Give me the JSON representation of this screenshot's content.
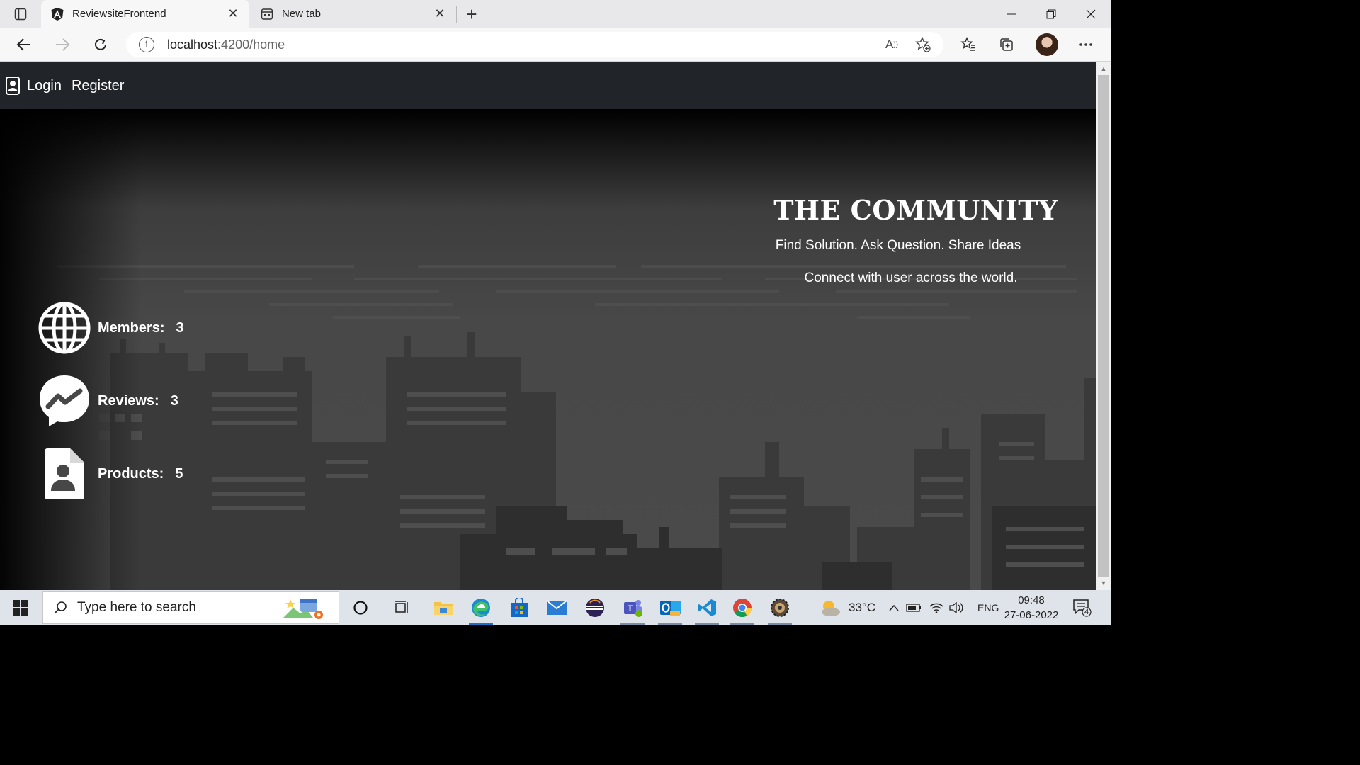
{
  "browser": {
    "tabs": [
      {
        "title": "ReviewsiteFrontend",
        "active": true
      },
      {
        "title": "New tab",
        "active": false
      }
    ],
    "url_host": "localhost",
    "url_path": ":4200/home"
  },
  "navbar": {
    "login_label": "Login",
    "register_label": "Register"
  },
  "hero": {
    "title": "THE COMMUNITY",
    "tagline": "Find Solution. Ask Question. Share Ideas",
    "subtitle": "Connect with user across the world."
  },
  "stats": [
    {
      "icon": "globe-icon",
      "label": "Members:",
      "value": "3"
    },
    {
      "icon": "chat-icon",
      "label": "Reviews:",
      "value": "3"
    },
    {
      "icon": "document-user-icon",
      "label": "Products:",
      "value": "5"
    }
  ],
  "taskbar": {
    "search_placeholder": "Type here to search",
    "weather": "33°C",
    "language": "ENG",
    "time": "09:48",
    "date": "27-06-2022",
    "notification_count": "4"
  },
  "colors": {
    "navbar_bg": "#212529",
    "hero_bg": "#4a4a4a",
    "text": "#ffffff",
    "taskbar_bg": "#dfe3ea"
  }
}
